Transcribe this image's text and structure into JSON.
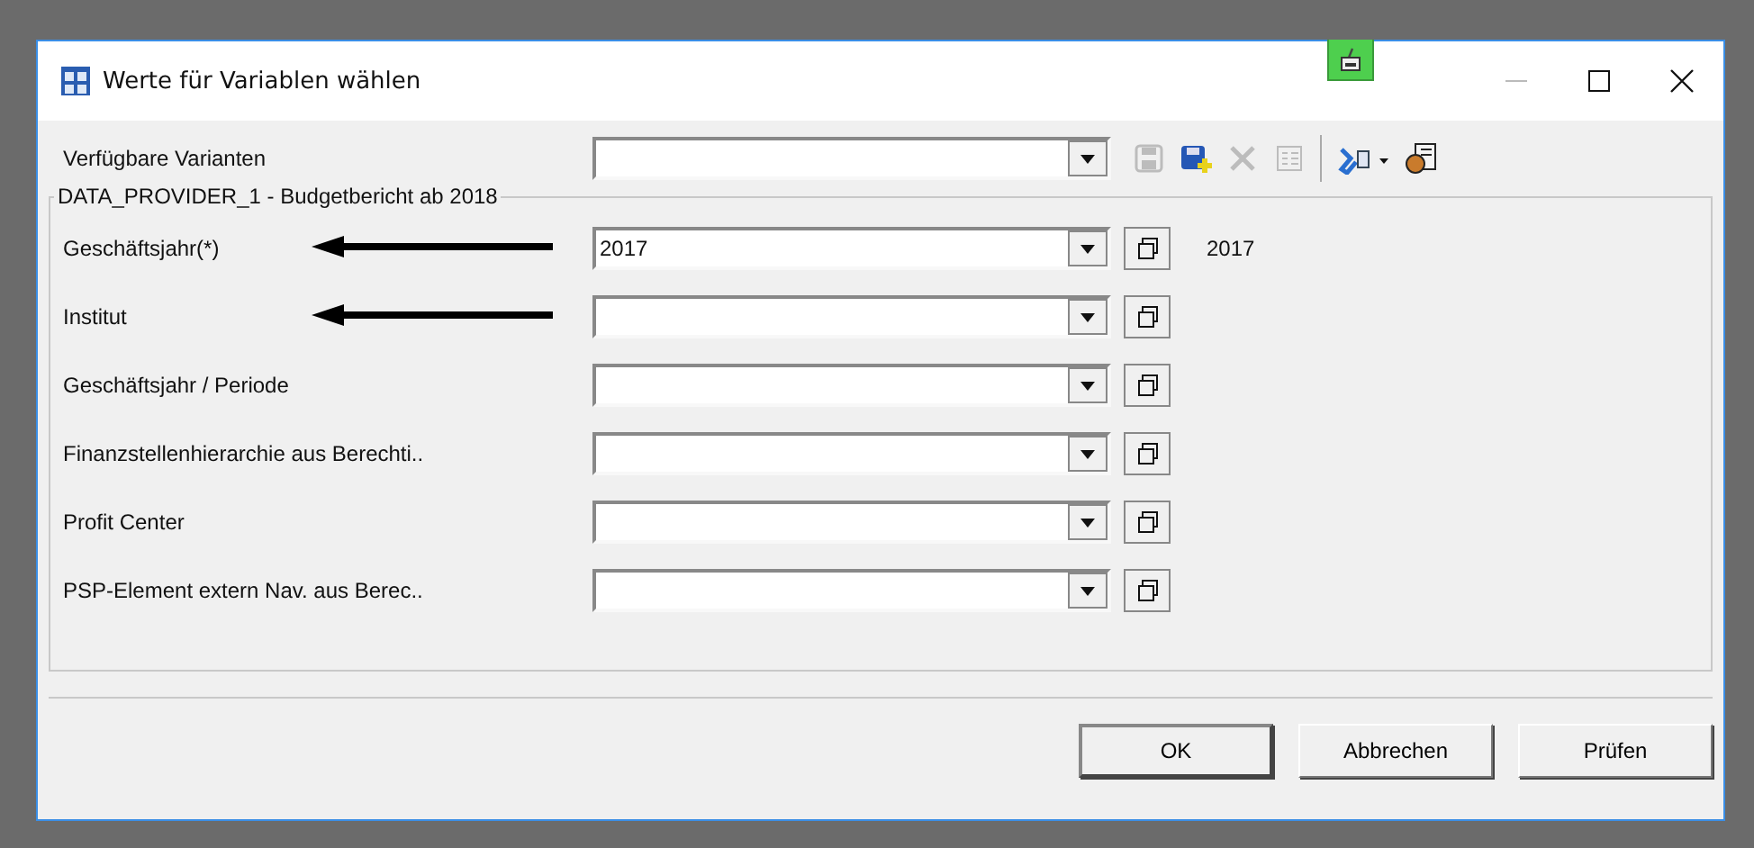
{
  "window": {
    "title": "Werte für Variablen wählen"
  },
  "variants": {
    "label": "Verfügbare Varianten"
  },
  "toolbar": [
    {
      "kind": "save",
      "disabled": true
    },
    {
      "kind": "save-as",
      "disabled": false
    },
    {
      "kind": "delete",
      "disabled": true
    },
    {
      "kind": "list",
      "disabled": true
    },
    {
      "kind": "separator"
    },
    {
      "kind": "tools",
      "disabled": false
    },
    {
      "kind": "personalize",
      "disabled": false
    }
  ],
  "group": {
    "title": "DATA_PROVIDER_1 - Budgetbericht ab 2018",
    "rows": [
      {
        "label": "Geschäftsjahr(*)",
        "value": "2017",
        "description": "2017",
        "marked": true
      },
      {
        "label": "Institut",
        "marked": true
      },
      {
        "label": "Geschäftsjahr / Periode",
        "marked": false
      },
      {
        "label": "Finanzstellenhierarchie  aus Berechti..",
        "marked": false
      },
      {
        "label": "Profit Center",
        "marked": false
      },
      {
        "label": "PSP-Element extern Nav. aus Berec..",
        "marked": false
      }
    ]
  },
  "buttons": [
    {
      "label": "OK",
      "default": true
    },
    {
      "label": "Abbrechen",
      "default": false
    },
    {
      "label": "Prüfen",
      "default": false
    }
  ]
}
